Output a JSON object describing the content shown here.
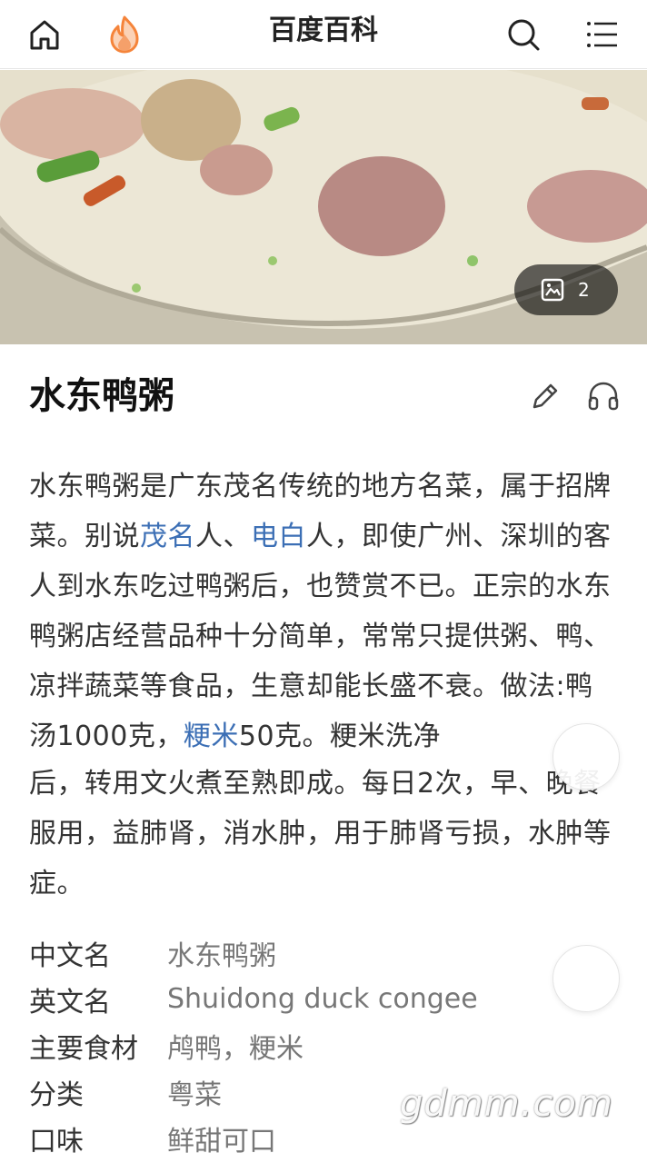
{
  "header": {
    "title": "百度百科",
    "icons": {
      "home": "home-icon",
      "hot": "fire-icon",
      "search": "search-icon",
      "menu": "menu-icon"
    }
  },
  "hero": {
    "gallery_count": "2",
    "gallery_icon": "gallery-icon"
  },
  "entry": {
    "title": "水东鸭粥",
    "summary": {
      "seg1": "水东鸭粥是广东茂名传统的地方名菜，属于招牌菜。别说",
      "link1": "茂名",
      "seg2": "人、",
      "link2": "电白",
      "seg3": "人，即使广州、深圳的客人到水东吃过鸭粥后，也赞赏不已。正宗的水东鸭粥店经营品种十分简单，常常只提供粥、鸭、凉拌蔬菜等食品，生意却能长盛不衰。做法:鸭汤1000克，",
      "link3": "粳米",
      "seg4": "50克。粳米洗净",
      "tail": "后，转用文火煮至熟即成。每日2次，早、晚餐服用，益肺肾，消水肿，用于肺肾亏损，水肿等症。"
    }
  },
  "info": [
    {
      "key": "中文名",
      "value": "水东鸭粥"
    },
    {
      "key": "英文名",
      "value": "Shuidong duck congee"
    },
    {
      "key": "主要食材",
      "value": "鸬鸭，粳米"
    },
    {
      "key": "分类",
      "value": "粤菜"
    },
    {
      "key": "口味",
      "value": "鲜甜可口"
    }
  ],
  "watermark": "gdmm.com",
  "colors": {
    "link": "#3c6fb5",
    "accent_fire": "#f5843a"
  }
}
